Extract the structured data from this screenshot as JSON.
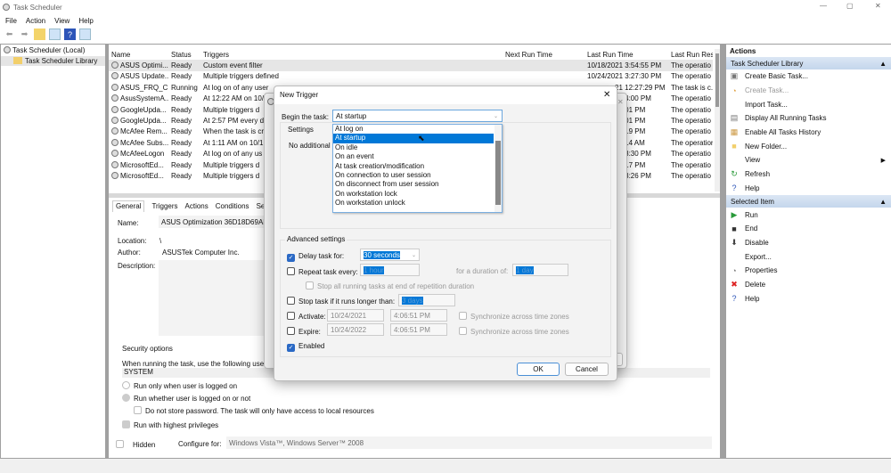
{
  "window": {
    "title": "Task Scheduler"
  },
  "menu": [
    "File",
    "Action",
    "View",
    "Help"
  ],
  "tree": {
    "root": "Task Scheduler (Local)",
    "library": "Task Scheduler Library"
  },
  "list": {
    "columns": [
      "Name",
      "Status",
      "Triggers",
      "Next Run Time",
      "Last Run Time",
      "Last Run Res"
    ],
    "rows": [
      [
        "ASUS Optimi...",
        "Ready",
        "Custom event filter",
        "",
        "10/18/2021 3:54:55 PM",
        "The operatio"
      ],
      [
        "ASUS Update...",
        "Ready",
        "Multiple triggers defined",
        "",
        "10/24/2021 3:27:30 PM",
        "The operatio"
      ],
      [
        "ASUS_FRQ_C...",
        "Running",
        "At log on of any user",
        "",
        "21 12:27:29 PM",
        "The task is c."
      ],
      [
        "AsusSystemA...",
        "Ready",
        "At 12:22 AM on 10/",
        "",
        "2:34:00 PM",
        "The operatio"
      ],
      [
        "GoogleUpda...",
        "Ready",
        "Multiple triggers d",
        "",
        "57:01 PM",
        "The operatio"
      ],
      [
        "GoogleUpda...",
        "Ready",
        "At 2:57 PM every da",
        "",
        "57:01 PM",
        "The operatio"
      ],
      [
        "McAfee Rem...",
        "Ready",
        "When the task is cr",
        "",
        "09:19 PM",
        "The operatio"
      ],
      [
        "McAfee Subs...",
        "Ready",
        "At 1:11 AM on 10/1",
        "",
        "17:14 AM",
        "The operatior"
      ],
      [
        "McAfeeLogon",
        "Ready",
        "At log on of any us",
        "",
        "2:28:30 PM",
        "The operatio"
      ],
      [
        "MicrosoftEd...",
        "Ready",
        "Multiple triggers d",
        "",
        "53:17 PM",
        "The operatio"
      ],
      [
        "MicrosoftEd...",
        "Ready",
        "Multiple triggers d",
        "",
        "2:33:26 PM",
        "The operatio"
      ]
    ]
  },
  "details": {
    "tabs": [
      "General",
      "Triggers",
      "Actions",
      "Conditions",
      "Settir"
    ],
    "name_label": "Name:",
    "name": "ASUS Optimization 36D18D69AFC",
    "location_label": "Location:",
    "location": "\\",
    "author_label": "Author:",
    "author": "ASUSTek Computer Inc.",
    "description_label": "Description:",
    "security_title": "Security options",
    "security_text": "When running the task, use the following user",
    "user": "SYSTEM",
    "radio1": "Run only when user is logged on",
    "radio2": "Run whether user is logged on or not",
    "no_store": "Do not store password.  The task will only have access to local resources",
    "highest": "Run with highest privileges",
    "hidden": "Hidden",
    "configure_label": "Configure for:",
    "configure": "Windows Vista™, Windows Server™ 2008"
  },
  "actions": {
    "header": "Actions",
    "section1": "Task Scheduler Library",
    "items1": [
      "Create Basic Task...",
      "Create Task...",
      "Import Task...",
      "Display All Running Tasks",
      "Enable All Tasks History",
      "New Folder...",
      "View",
      "Refresh",
      "Help"
    ],
    "section2": "Selected Item",
    "items2": [
      "Run",
      "End",
      "Disable",
      "Export...",
      "Properties",
      "Delete",
      "Help"
    ]
  },
  "dialog": {
    "title": "New Trigger",
    "begin_label": "Begin the task:",
    "begin_value": "At startup",
    "options": [
      "At log on",
      "At startup",
      "On idle",
      "On an event",
      "At task creation/modification",
      "On connection to user session",
      "On disconnect from user session",
      "On workstation lock",
      "On workstation unlock"
    ],
    "selected_option": "At startup",
    "settings_title": "Settings",
    "no_additional": "No additional",
    "advanced_title": "Advanced settings",
    "delay_label": "Delay task for:",
    "delay_value": "30 seconds",
    "delay_checked": true,
    "repeat_label": "Repeat task every:",
    "repeat_value": "1 hour",
    "duration_label": "for a duration of:",
    "duration_value": "1 day",
    "stop_all": "Stop all running tasks at end of repetition duration",
    "stop_longer": "Stop task if it runs longer than:",
    "stop_value": "3 days",
    "activate_label": "Activate:",
    "activate_date": "10/24/2021",
    "activate_time": "4:06:51 PM",
    "expire_label": "Expire:",
    "expire_date": "10/24/2022",
    "expire_time": "4:06:51 PM",
    "sync": "Synchronize across time zones",
    "enabled": "Enabled",
    "enabled_checked": true,
    "ok": "OK",
    "cancel": "Cancel"
  }
}
